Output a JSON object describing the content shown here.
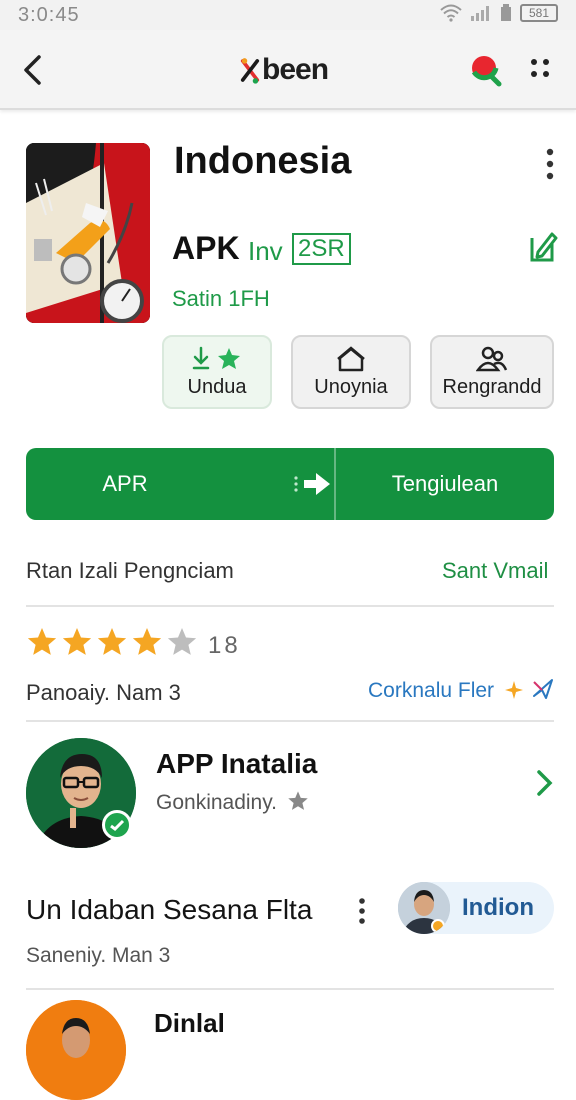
{
  "status_bar": {
    "time": "3:0:45",
    "battery": "581"
  },
  "app_bar": {
    "brand": "been"
  },
  "app": {
    "title": "Indonesia",
    "apk_label": "APK",
    "version": "Inv",
    "badge": "2SR",
    "subtitle": "Satin 1FH"
  },
  "chips": [
    {
      "label": "Undua",
      "icon": "download-star-icon"
    },
    {
      "label": "Unoynia",
      "icon": "home-icon"
    },
    {
      "label": "Rengrandd",
      "icon": "users-icon"
    }
  ],
  "install_button": {
    "left_label": "APR",
    "right_label": "Tengiulean"
  },
  "info_row": {
    "left": "Rtan Izali Pengnciam",
    "right": "Sant Vmail"
  },
  "rating": {
    "value": "18",
    "stars_filled": 4,
    "stars_total": 5
  },
  "review_row": {
    "left": "Panoaiy. Nam 3",
    "link": "Corknalu Fler"
  },
  "list_item_1": {
    "title": "APP Inatalia",
    "subtitle": "Gonkinadiny."
  },
  "list_item_2": {
    "title": "Un Idaban Sesana Flta",
    "pill_label": "Indion",
    "subtitle": "Saneniy. Man 3"
  },
  "list_item_3": {
    "title": "Dinlal"
  },
  "colors": {
    "accent_green": "#14913f",
    "link_blue": "#2a78c0",
    "star": "#f5a623"
  }
}
